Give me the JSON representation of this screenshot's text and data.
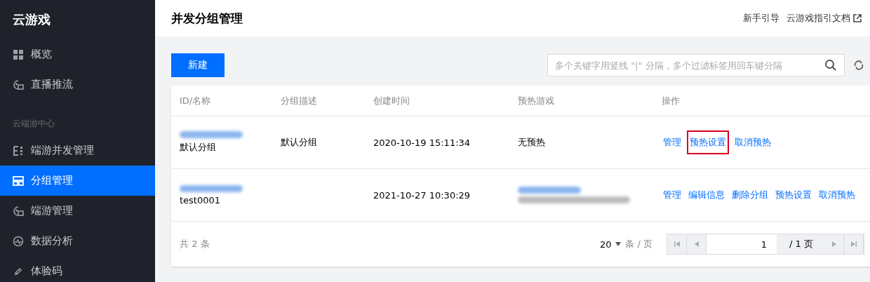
{
  "sidebar": {
    "title": "云游戏",
    "items": [
      {
        "kind": "item",
        "label": "概览",
        "selected": false
      },
      {
        "kind": "item",
        "label": "直播推流",
        "selected": false
      },
      {
        "kind": "section",
        "label": "云端游中心"
      },
      {
        "kind": "item",
        "label": "端游并发管理",
        "selected": false
      },
      {
        "kind": "item",
        "label": "分组管理",
        "selected": true
      },
      {
        "kind": "item",
        "label": "端游管理",
        "selected": false
      },
      {
        "kind": "item",
        "label": "数据分析",
        "selected": false
      },
      {
        "kind": "item",
        "label": "体验码",
        "selected": false
      }
    ]
  },
  "header": {
    "title": "并发分组管理",
    "links": [
      "新手引导",
      "云游戏指引文档"
    ]
  },
  "toolbar": {
    "new_button": "新建",
    "search": {
      "placeholder": "多个关键字用竖线 \"|\" 分隔，多个过滤标签用回车键分隔"
    }
  },
  "table": {
    "columns": [
      "ID/名称",
      "分组描述",
      "创建时间",
      "预热游戏",
      "操作"
    ],
    "rows": [
      {
        "name": "默认分组",
        "description": "默认分组",
        "created": "2020-10-19 15:11:34",
        "preheat": "无预热",
        "actions": [
          {
            "label": "管理",
            "highlighted": false
          },
          {
            "label": "预热设置",
            "highlighted": true
          },
          {
            "label": "取消预热",
            "highlighted": false
          }
        ]
      },
      {
        "name": "test0001",
        "created": "2021-10-27 10:30:29",
        "actions": [
          {
            "label": "管理",
            "highlighted": false
          },
          {
            "label": "编辑信息",
            "highlighted": false
          },
          {
            "label": "删除分组",
            "highlighted": false
          },
          {
            "label": "预热设置",
            "highlighted": false
          },
          {
            "label": "取消预热",
            "highlighted": false
          }
        ]
      }
    ]
  },
  "footer": {
    "total": "共 2 条",
    "page_size": "20",
    "page_size_unit": "条 / 页",
    "page": "1",
    "page_total": "/ 1 页"
  }
}
